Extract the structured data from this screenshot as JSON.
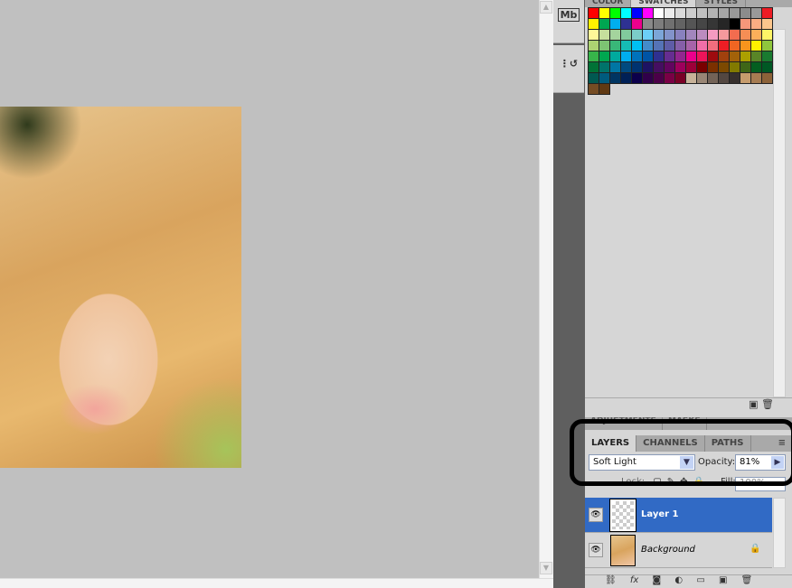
{
  "swatches_panel": {
    "tabs": [
      "COLOR",
      "SWATCHES",
      "STYLES"
    ],
    "active_tab": "SWATCHES",
    "colors": [
      "#ff0000",
      "#ffff00",
      "#00ff00",
      "#00ffff",
      "#0000ff",
      "#ff00ff",
      "#ffffff",
      "#ebebeb",
      "#d9d9d9",
      "#cccccc",
      "#c0c0c0",
      "#b3b3b3",
      "#a6a6a6",
      "#999999",
      "#8c8c8c",
      "#999999",
      "#ed1c24",
      "#fff200",
      "#00a651",
      "#00aeef",
      "#2e3192",
      "#ec008c",
      "#898989",
      "#7d7d7d",
      "#707070",
      "#636363",
      "#555555",
      "#464646",
      "#363636",
      "#262626",
      "#000000",
      "#f7977a",
      "#fbad82",
      "#fdc68c",
      "#fff799",
      "#c6df9c",
      "#a4d49d",
      "#81ca9d",
      "#7bcdc9",
      "#6ccff7",
      "#7ca6d8",
      "#8293ca",
      "#8881be",
      "#a286bd",
      "#bc8cbf",
      "#f49bc1",
      "#f5999d",
      "#f26c4f",
      "#f68e55",
      "#fbaf5a",
      "#fff467",
      "#acd372",
      "#7dc473",
      "#39b778",
      "#16bcb4",
      "#00bff3",
      "#438ccb",
      "#5573b7",
      "#5e5ca7",
      "#855fa8",
      "#a763a9",
      "#ef6ea8",
      "#f16d7e",
      "#ee1d24",
      "#f16522",
      "#f7941d",
      "#fff100",
      "#8fc63d",
      "#37b44a",
      "#00a650",
      "#00a99e",
      "#00aeef",
      "#0072bc",
      "#0054a5",
      "#2f3090",
      "#662d91",
      "#92278f",
      "#ec008c",
      "#ed145a",
      "#9e0b0f",
      "#a0410d",
      "#a36209",
      "#aba000",
      "#598527",
      "#1a7b30",
      "#007236",
      "#00736a",
      "#0076a4",
      "#004a80",
      "#003370",
      "#1d1363",
      "#450e61",
      "#62055f",
      "#9e005c",
      "#9d0039",
      "#790000",
      "#7b3000",
      "#7c4900",
      "#827a00",
      "#3e6617",
      "#045f20",
      "#005824",
      "#005951",
      "#005b7e",
      "#003562",
      "#002056",
      "#0c004b",
      "#30004a",
      "#4b0048",
      "#7a0045",
      "#7a0026",
      "#c7b299",
      "#998675",
      "#736357",
      "#534741",
      "#362f2d",
      "#c69c6d",
      "#a67c52",
      "#8c6239",
      "#754c24",
      "#603913"
    ]
  },
  "adjustments_tabs": [
    "ADJUSTMENTS",
    "MASKS"
  ],
  "layers_panel": {
    "tabs": [
      "LAYERS",
      "CHANNELS",
      "PATHS"
    ],
    "active_tab": "LAYERS",
    "blend_mode": "Soft Light",
    "opacity_label": "Opacity:",
    "opacity": "81%",
    "lock_label": "Lock:",
    "fill_label": "Fill:",
    "fill": "100%",
    "layers": [
      {
        "name": "Layer 1",
        "selected": true,
        "visible": true
      },
      {
        "name": "Background",
        "selected": false,
        "visible": true,
        "locked": true
      }
    ]
  },
  "dock": {
    "icons": [
      "mini-bridge-icon",
      "history-icon"
    ],
    "mini_bridge_label": "Mb"
  },
  "accent": "#316ac5"
}
